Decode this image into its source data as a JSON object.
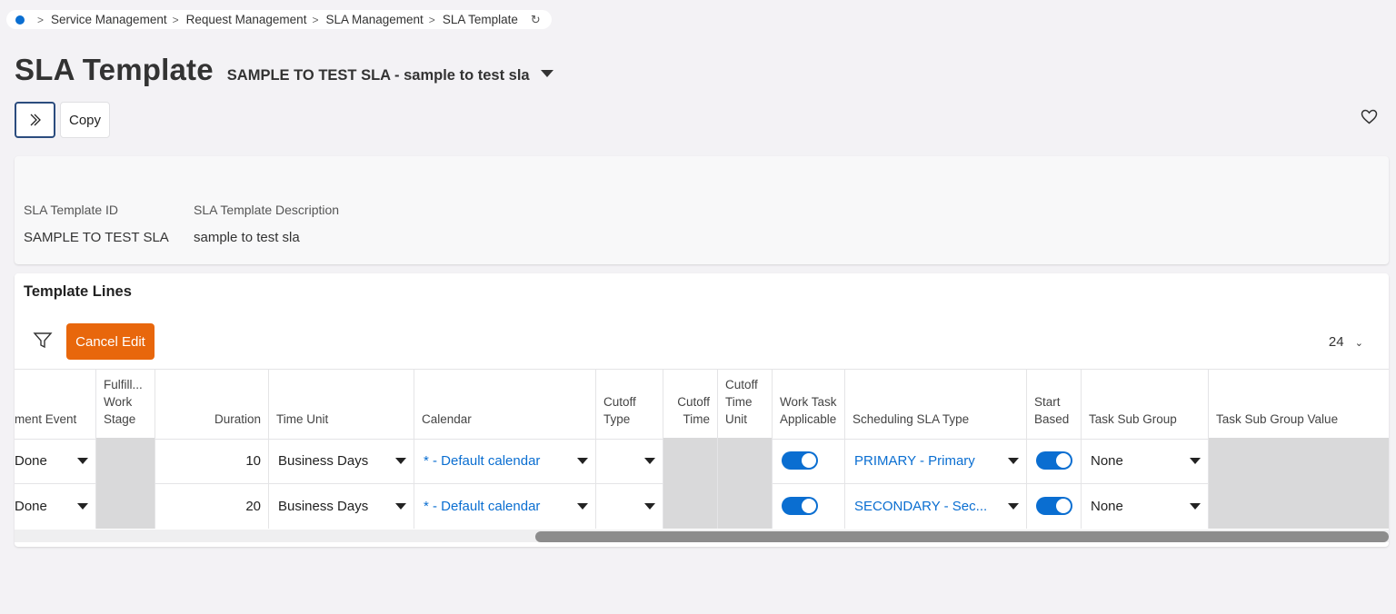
{
  "breadcrumb": {
    "items": [
      "Service Management",
      "Request Management",
      "SLA Management",
      "SLA Template"
    ]
  },
  "page": {
    "title": "SLA Template",
    "subtitle": "SAMPLE TO TEST SLA - sample to test sla"
  },
  "toolbar": {
    "expand_icon": "double-chevron-right-icon",
    "copy_label": "Copy"
  },
  "header_fields": {
    "id_label": "SLA Template ID",
    "id_value": "SAMPLE TO TEST SLA",
    "desc_label": "SLA Template Description",
    "desc_value": "sample to test sla"
  },
  "template_lines": {
    "title": "Template Lines",
    "cancel_edit_label": "Cancel Edit",
    "page_size": "24",
    "columns": {
      "event": "ment Event",
      "fulfill": "Fulfill... Work Stage",
      "duration": "Duration",
      "time_unit": "Time Unit",
      "calendar": "Calendar",
      "cutoff_type": "Cutoff Type",
      "cutoff_time": "Cutoff Time",
      "cutoff_time_unit": "Cutoff Time Unit",
      "work_task": "Work Task Applicable",
      "sched_sla": "Scheduling SLA Type",
      "start_based": "Start Based",
      "task_sub_group": "Task Sub Group",
      "task_sub_group_value": "Task Sub Group Value"
    },
    "rows": [
      {
        "event": "Done",
        "duration": "10",
        "time_unit": "Business Days",
        "calendar": "* - Default calendar",
        "work_task": true,
        "sched_sla": "PRIMARY - Primary",
        "start_based": true,
        "task_sub_group": "None"
      },
      {
        "event": "Done",
        "duration": "20",
        "time_unit": "Business Days",
        "calendar": "* - Default calendar",
        "work_task": true,
        "sched_sla": "SECONDARY - Sec...",
        "start_based": true,
        "task_sub_group": "None"
      }
    ]
  },
  "colors": {
    "accent": "#0a6ed1",
    "cancel_button": "#e8670c",
    "background": "#f3f2f5"
  }
}
